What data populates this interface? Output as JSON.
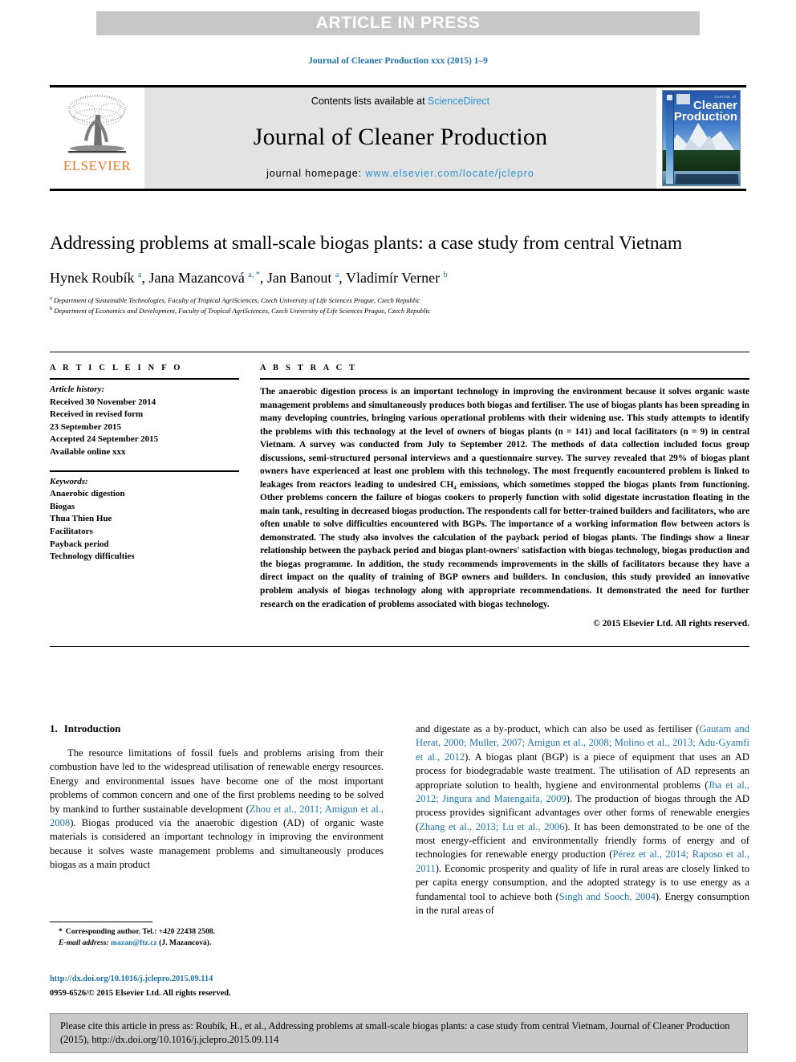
{
  "banner": {
    "text": "ARTICLE IN PRESS"
  },
  "running_head": "Journal of Cleaner Production xxx (2015) 1–9",
  "masthead": {
    "publisher_logo_label": "ELSEVIER",
    "contents_prefix": "Contents lists available at ",
    "contents_link": "ScienceDirect",
    "journal_title": "Journal of Cleaner Production",
    "homepage_prefix": "journal homepage: ",
    "homepage_url": "www.elsevier.com/locate/jclepro",
    "cover": {
      "kicker": "Journal of",
      "line1": "Cleaner",
      "line2": "Production"
    }
  },
  "article": {
    "title": "Addressing problems at small-scale biogas plants: a case study from central Vietnam",
    "authors_html": "Hynek Roubík <sup>a</sup>, Jana Mazancová <sup>a, *</sup>, Jan Banout <sup>a</sup>, Vladimír Verner <sup>b</sup>",
    "affiliation_a": "Department of Sustainable Technologies, Faculty of Tropical AgriSciences, Czech University of Life Sciences Prague, Czech Republic",
    "affiliation_b": "Department of Economics and Development, Faculty of Tropical AgriSciences, Czech University of Life Sciences Prague, Czech Republic"
  },
  "article_info": {
    "heading": "A R T I C L E   I N F O",
    "history_label": "Article history:",
    "history": [
      "Received 30 November 2014",
      "Received in revised form",
      "23 September 2015",
      "Accepted 24 September 2015",
      "Available online xxx"
    ],
    "keywords_label": "Keywords:",
    "keywords": [
      "Anaerobic digestion",
      "Biogas",
      "Thua Thien Hue",
      "Facilitators",
      "Payback period",
      "Technology difficulties"
    ]
  },
  "abstract": {
    "heading": "A B S T R A C T",
    "text": "The anaerobic digestion process is an important technology in improving the environment because it solves organic waste management problems and simultaneously produces both biogas and fertiliser. The use of biogas plants has been spreading in many developing countries, bringing various operational problems with their widening use. This study attempts to identify the problems with this technology at the level of owners of biogas plants (n = 141) and local facilitators (n = 9) in central Vietnam. A survey was conducted from July to September 2012. The methods of data collection included focus group discussions, semi-structured personal interviews and a questionnaire survey. The survey revealed that 29% of biogas plant owners have experienced at least one problem with this technology. The most frequently encountered problem is linked to leakages from reactors leading to undesired CH₄ emissions, which sometimes stopped the biogas plants from functioning. Other problems concern the failure of biogas cookers to properly function with solid digestate incrustation floating in the main tank, resulting in decreased biogas production. The respondents call for better-trained builders and facilitators, who are often unable to solve difficulties encountered with BGPs. The importance of a working information flow between actors is demonstrated. The study also involves the calculation of the payback period of biogas plants. The findings show a linear relationship between the payback period and biogas plant-owners' satisfaction with biogas technology, biogas production and the biogas programme. In addition, the study recommends improvements in the skills of facilitators because they have a direct impact on the quality of training of BGP owners and builders. In conclusion, this study provided an innovative problem analysis of biogas technology along with appropriate recommendations. It demonstrated the need for further research on the eradication of problems associated with biogas technology.",
    "copyright": "© 2015 Elsevier Ltd. All rights reserved."
  },
  "introduction": {
    "number": "1.",
    "heading": "Introduction",
    "left_html": "The resource limitations of fossil fuels and problems arising from their combustion have led to the widespread utilisation of renewable energy resources. Energy and environmental issues have become one of the most important problems of common concern and one of the first problems needing to be solved by mankind to further sustainable development (<span class=\"cite\">Zhou et al., 2011; Amigun et al., 2008</span>). Biogas produced via the anaerobic digestion (AD) of organic waste materials is considered an important technology in improving the environment because it solves waste management problems and simultaneously produces biogas as a main product",
    "right_html": "and digestate as a by-product, which can also be used as fertiliser (<span class=\"cite\">Gautam and Herat, 2000; Muller, 2007; Amigun et al., 2008; Molino et al., 2013; Adu-Gyamfi et al., 2012</span>). A biogas plant (BGP) is a piece of equipment that uses an AD process for biodegradable waste treatment. The utilisation of AD represents an appropriate solution to health, hygiene and environmental problems (<span class=\"cite\">Jha et al., 2012; Jingura and Matengaifa, 2009</span>). The production of biogas through the AD process provides significant advantages over other forms of renewable energies (<span class=\"cite\">Zhang et al., 2013; Lu et al., 2006</span>). It has been demonstrated to be one of the most energy-efficient and environmentally friendly forms of energy and of technologies for renewable energy production (<span class=\"cite\">Pérez et al., 2014; Raposo et al., 2011</span>). Economic prosperity and quality of life in rural areas are closely linked to per capita energy consumption, and the adopted strategy is to use energy as a fundamental tool to achieve both (<span class=\"cite\">Singh and Sooch, 2004</span>). Energy consumption in the rural areas of"
  },
  "footnotes": {
    "corresponding_star": "*",
    "corresponding": "Corresponding author. Tel.: +420 22438 2508.",
    "email_label": "E-mail address:",
    "email": "mazan@ftz.cz",
    "email_owner": "(J. Mazancová)."
  },
  "doi_block": {
    "doi_url": "http://dx.doi.org/10.1016/j.jclepro.2015.09.114",
    "issn_line": "0959-6526/© 2015 Elsevier Ltd. All rights reserved."
  },
  "cite_box": {
    "text": "Please cite this article in press as: Roubík, H., et al., Addressing problems at small-scale biogas plants: a case study from central Vietnam, Journal of Cleaner Production (2015), http://dx.doi.org/10.1016/j.jclepro.2015.09.114"
  },
  "colors": {
    "link_blue": "#1f74a8",
    "sd_blue": "#2f93d1",
    "elsevier_orange": "#e87722",
    "banner_gray": "#c7c7c7",
    "masthead_gray": "#e3e3e3",
    "cite_box_gray": "#c9c9c9"
  }
}
